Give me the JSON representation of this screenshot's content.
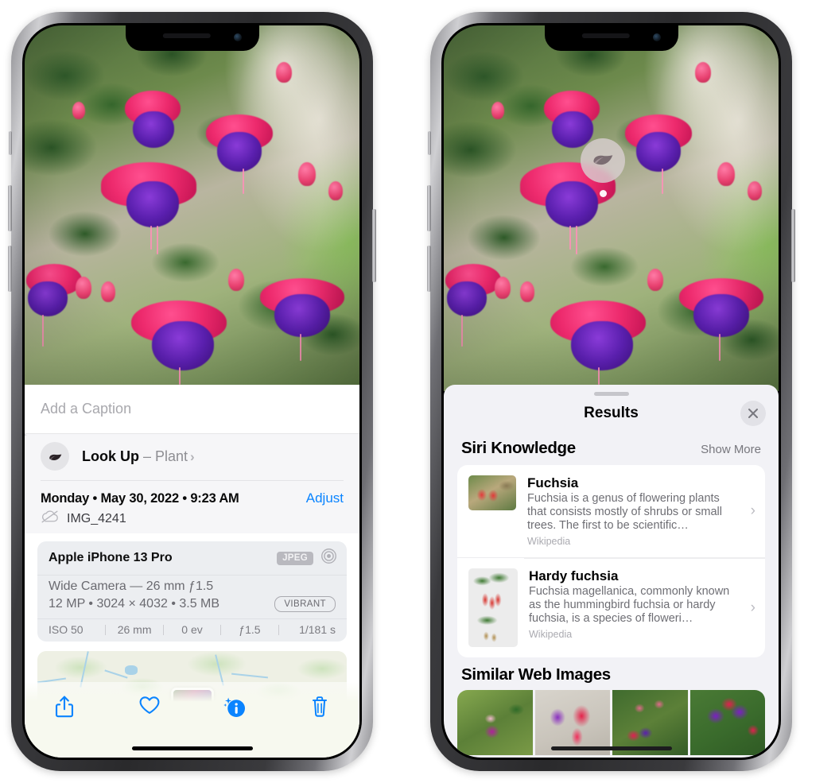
{
  "left_phone": {
    "caption": {
      "placeholder": "Add a Caption",
      "value": ""
    },
    "lookup": {
      "label": "Look Up",
      "dash": " – ",
      "subject": "Plant",
      "icon": "leaf-icon",
      "chevron": "›"
    },
    "meta": {
      "date": "Monday • May 30, 2022 • 9:23 AM",
      "adjust_label": "Adjust",
      "filename": "IMG_4241",
      "cloud_icon": "icloud-slash-icon"
    },
    "camera": {
      "model": "Apple iPhone 13 Pro",
      "format_badge": "JPEG",
      "lens_icon": "aperture-icon",
      "lens_line": "Wide Camera — 26 mm ƒ1.5",
      "spec_line": "12 MP • 3024 × 4032 • 3.5 MB",
      "style_badge": "VIBRANT",
      "exif": [
        "ISO 50",
        "26 mm",
        "0 ev",
        "ƒ1.5",
        "1/181 s"
      ]
    },
    "toolbar": [
      {
        "name": "share-button",
        "icon": "share-icon"
      },
      {
        "name": "favorite-button",
        "icon": "heart-icon"
      },
      {
        "name": "info-button",
        "icon": "info-sparkle-icon"
      },
      {
        "name": "delete-button",
        "icon": "trash-icon"
      }
    ],
    "accent_color": "#0a84ff"
  },
  "right_phone": {
    "badge": {
      "icon": "leaf-icon"
    },
    "results": {
      "title": "Results",
      "close_icon": "close-icon",
      "siri": {
        "section_title": "Siri Knowledge",
        "show_more": "Show More",
        "items": [
          {
            "title": "Fuchsia",
            "desc": "Fuchsia is a genus of flowering plants that consists mostly of shrubs or small trees. The first to be scientific…",
            "source": "Wikipedia",
            "chevron": "›"
          },
          {
            "title": "Hardy fuchsia",
            "desc": "Fuchsia magellanica, commonly known as the hummingbird fuchsia or hardy fuchsia, is a species of floweri…",
            "source": "Wikipedia",
            "chevron": "›"
          }
        ]
      },
      "web": {
        "section_title": "Similar Web Images",
        "images": [
          "fuchsia-web-image-1",
          "fuchsia-web-image-2",
          "fuchsia-web-image-3",
          "fuchsia-web-image-4"
        ]
      }
    }
  }
}
